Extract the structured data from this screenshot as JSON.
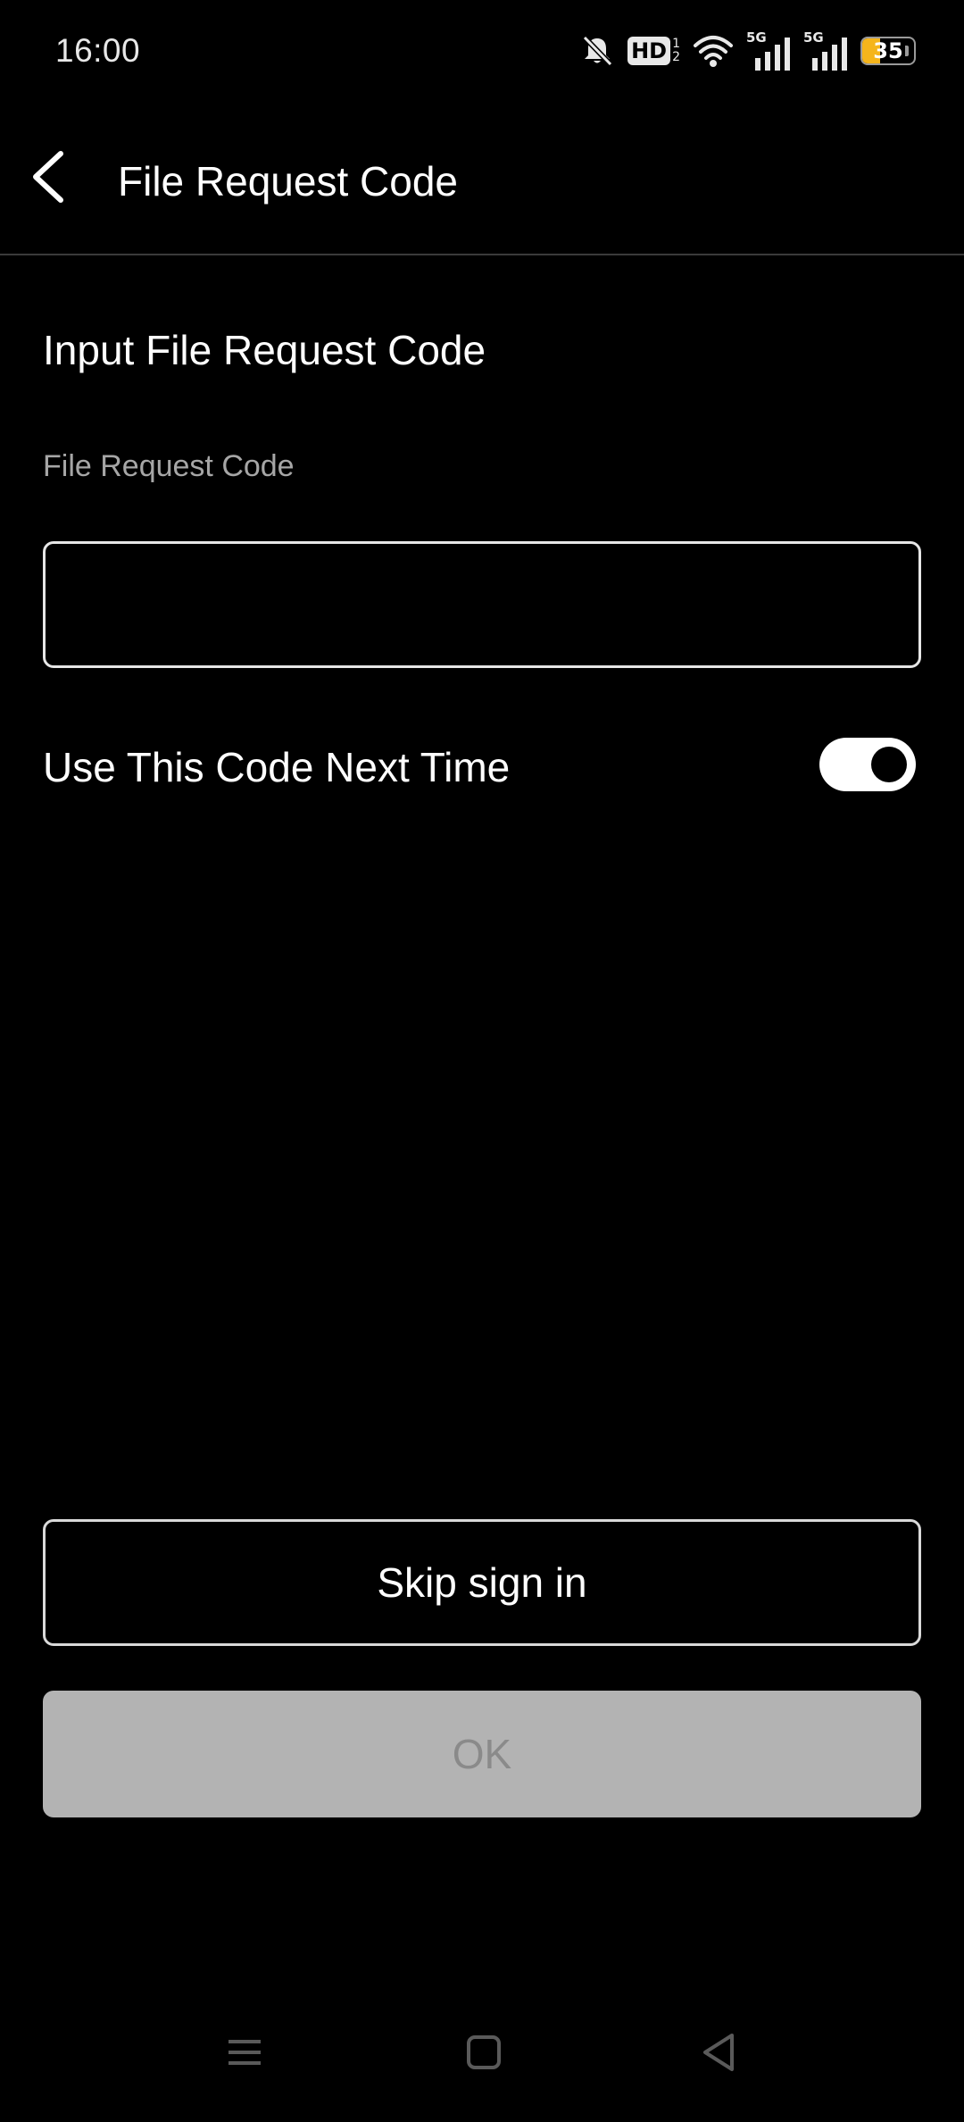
{
  "status_bar": {
    "time": "16:00",
    "icons": [
      "bell-muted-icon",
      "hd-voice-icon",
      "wifi-icon",
      "signal-5g-icon",
      "signal-5g-icon",
      "battery-icon"
    ],
    "hd_label": "HD",
    "hd_sub_top": "1",
    "hd_sub_bottom": "2",
    "network_1": "5G",
    "network_2": "5G",
    "battery_percent": "35",
    "battery_level": 0.35,
    "battery_color": "#f5b51b"
  },
  "app_bar": {
    "back_icon": "chevron-left-icon",
    "title": "File Request Code"
  },
  "form": {
    "section_title": "Input File Request Code",
    "field_label": "File Request Code",
    "code_value": "",
    "toggle_label": "Use This Code Next Time",
    "toggle_on": true
  },
  "buttons": {
    "skip_label": "Skip sign in",
    "ok_label": "OK",
    "ok_enabled": false
  },
  "nav_bar": {
    "icons": [
      "menu-icon",
      "home-square-icon",
      "back-triangle-icon"
    ]
  },
  "colors": {
    "background": "#000000",
    "text": "#ffffff",
    "muted_text": "#a6a6a6",
    "disabled_button": "#b3b3b3",
    "disabled_text": "#8a8a8a"
  }
}
